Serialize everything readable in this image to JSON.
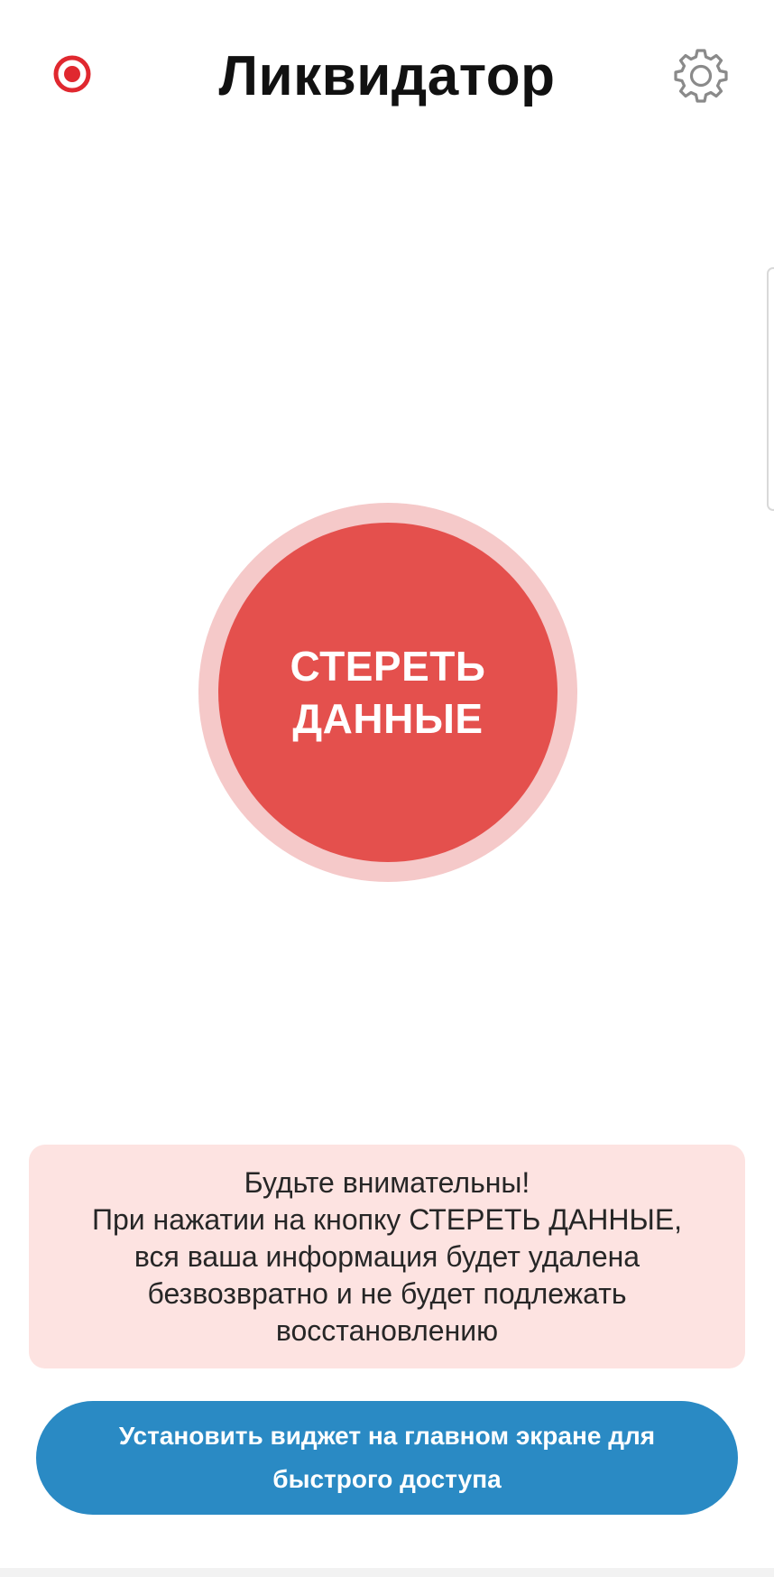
{
  "app": {
    "title": "Ликвидатор"
  },
  "header": {
    "record_icon": "record-icon",
    "settings_icon": "gear-icon"
  },
  "main": {
    "erase_button_label": "СТЕРЕТЬ\nДАННЫЕ"
  },
  "warning": {
    "text": "Будьте внимательны!\nПри нажатии на кнопку СТЕРЕТЬ ДАННЫЕ,\nвся ваша информация будет удалена\nбезвозвратно и не будет подлежать\nвосстановлению"
  },
  "footer": {
    "widget_button_label": "Установить виджет на главном экране для\nбыстрого доступа"
  },
  "colors": {
    "accent_red": "#e4504d",
    "ring_red": "#f5c9c9",
    "warning_bg": "#fde3e1",
    "button_blue": "#2a8ac4",
    "record_red": "#e0282f"
  }
}
